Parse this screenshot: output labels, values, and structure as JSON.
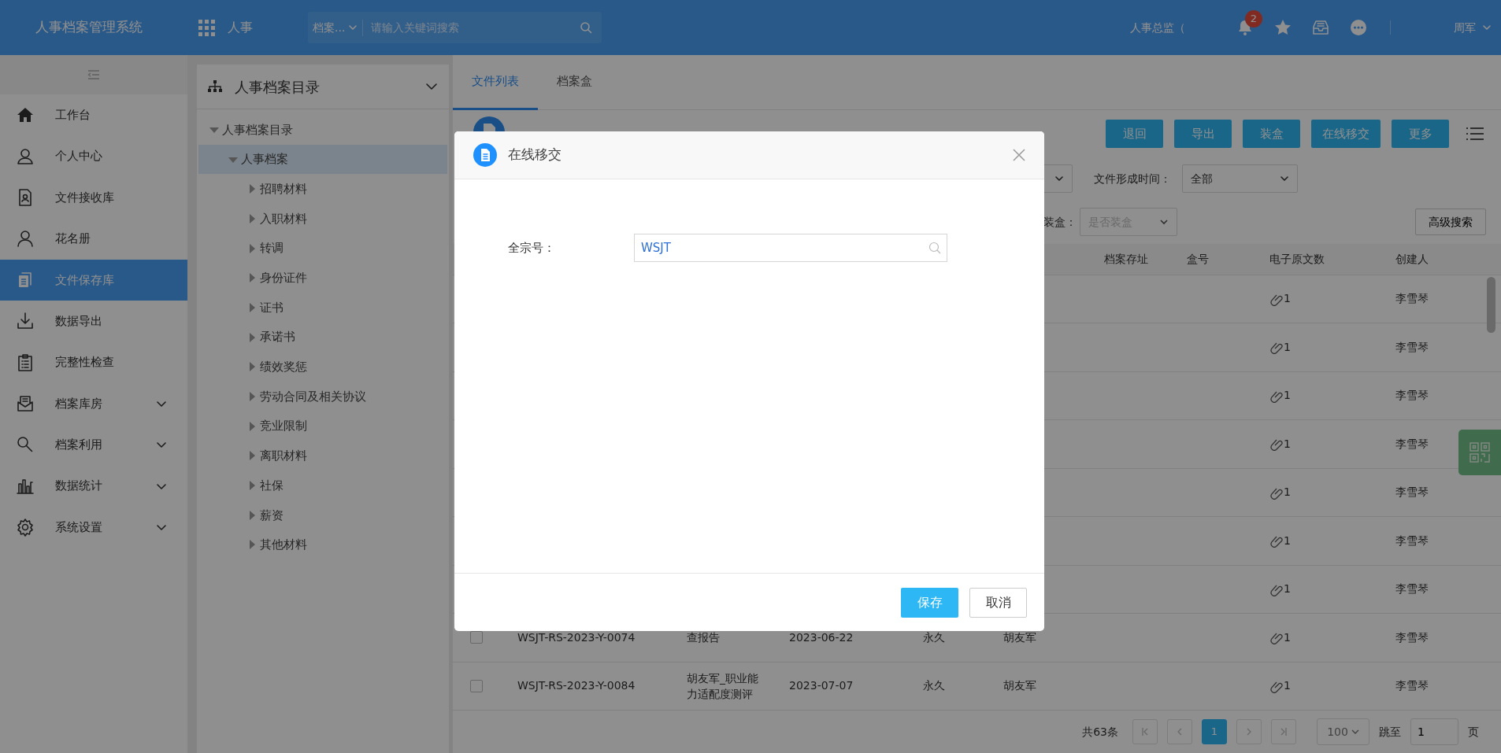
{
  "header": {
    "title": "人事档案管理系统",
    "module": "人事",
    "search": {
      "scope": "档案...",
      "placeholder": "请输入关键词搜索"
    },
    "role": "人事总监（",
    "notifications": "2",
    "user": "周军"
  },
  "sidebar": {
    "items": [
      {
        "label": "工作台",
        "selected": false,
        "expandable": false
      },
      {
        "label": "个人中心",
        "selected": false,
        "expandable": false
      },
      {
        "label": "文件接收库",
        "selected": false,
        "expandable": false
      },
      {
        "label": "花名册",
        "selected": false,
        "expandable": false
      },
      {
        "label": "文件保存库",
        "selected": true,
        "expandable": false
      },
      {
        "label": "数据导出",
        "selected": false,
        "expandable": false
      },
      {
        "label": "完整性检查",
        "selected": false,
        "expandable": false
      },
      {
        "label": "档案库房",
        "selected": false,
        "expandable": true
      },
      {
        "label": "档案利用",
        "selected": false,
        "expandable": true
      },
      {
        "label": "数据统计",
        "selected": false,
        "expandable": true
      },
      {
        "label": "系统设置",
        "selected": false,
        "expandable": true
      }
    ]
  },
  "tree": {
    "title": "人事档案目录",
    "nodes": [
      {
        "label": "人事档案目录",
        "expanded": true,
        "selected": false,
        "children": [
          {
            "label": "人事档案",
            "expanded": true,
            "selected": true,
            "children": [
              {
                "label": "招聘材料",
                "expanded": false,
                "selected": false
              },
              {
                "label": "入职材料",
                "expanded": false,
                "selected": false
              },
              {
                "label": "转调",
                "expanded": false,
                "selected": false
              },
              {
                "label": "身份证件",
                "expanded": false,
                "selected": false
              },
              {
                "label": "证书",
                "expanded": false,
                "selected": false
              },
              {
                "label": "承诺书",
                "expanded": false,
                "selected": false
              },
              {
                "label": "绩效奖惩",
                "expanded": false,
                "selected": false
              },
              {
                "label": "劳动合同及相关协议",
                "expanded": false,
                "selected": false
              },
              {
                "label": "竞业限制",
                "expanded": false,
                "selected": false
              },
              {
                "label": "离职材料",
                "expanded": false,
                "selected": false
              },
              {
                "label": "社保",
                "expanded": false,
                "selected": false
              },
              {
                "label": "薪资",
                "expanded": false,
                "selected": false
              },
              {
                "label": "其他材料",
                "expanded": false,
                "selected": false
              }
            ]
          }
        ]
      }
    ]
  },
  "tabs": [
    {
      "label": "文件列表",
      "selected": true
    },
    {
      "label": "档案盒",
      "selected": false
    }
  ],
  "toolbar": {
    "buttons": [
      "退回",
      "导出",
      "装盒",
      "在线移交",
      "更多"
    ]
  },
  "filters": {
    "date_label": "文件形成时间：",
    "date_value": "全部",
    "boxed_label": "装盒：",
    "boxed_placeholder": "是否装盒",
    "advanced_search": "高级搜索"
  },
  "table": {
    "columns": [
      "档案存址",
      "盒号",
      "电子原文数",
      "创建人"
    ],
    "rows": [
      {
        "attachments": "1",
        "creator": "李雪琴"
      },
      {
        "attachments": "1",
        "creator": "李雪琴"
      },
      {
        "attachments": "1",
        "creator": "李雪琴"
      },
      {
        "attachments": "1",
        "creator": "李雪琴"
      },
      {
        "attachments": "1",
        "creator": "李雪琴"
      },
      {
        "attachments": "1",
        "creator": "李雪琴"
      },
      {
        "attachments": "1",
        "creator": "李雪琴"
      },
      {
        "checked": false,
        "code": "WSJT-RS-2023-Y-0074",
        "title": "查报告",
        "date": "2023-06-22",
        "retention": "永久",
        "responsible": "胡友军",
        "attachments": "1",
        "creator": "李雪琴"
      },
      {
        "checked": false,
        "code": "WSJT-RS-2023-Y-0084",
        "title": "胡友军_职业能力适配度测评",
        "date": "2023-07-07",
        "retention": "永久",
        "responsible": "胡友军",
        "attachments": "1",
        "creator": "李雪琴"
      }
    ]
  },
  "pagination": {
    "total": "共63条",
    "pages": [
      {
        "label": "1",
        "selected": true
      }
    ],
    "page_size": "100",
    "goto_label": "跳至",
    "goto_value": "1",
    "page_unit": "页"
  },
  "modal": {
    "title": "在线移交",
    "fields": [
      {
        "label": "全宗号：",
        "value": "WSJT"
      }
    ],
    "buttons": [
      {
        "label": "保存",
        "kind": "primary"
      },
      {
        "label": "取消",
        "kind": "secondary"
      }
    ]
  }
}
